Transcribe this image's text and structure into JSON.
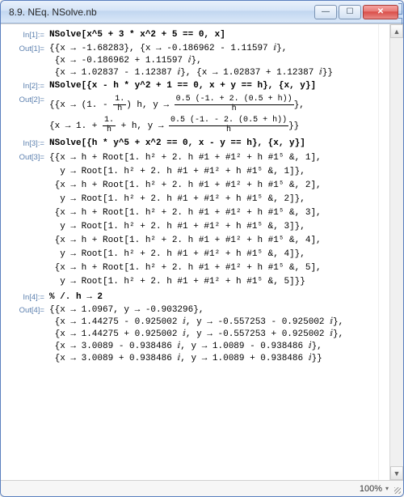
{
  "window": {
    "title": "8.9. NEq. NSolve.nb",
    "min_tooltip": "Minimize",
    "max_tooltip": "Maximize",
    "close_tooltip": "Close"
  },
  "status": {
    "zoom": "100%"
  },
  "cells": {
    "in1_label": "In[1]:=",
    "in1": "NSolve[x^5 + 3 * x^2 + 5 == 0, x]",
    "out1_label": "Out[1]=",
    "out1_l1": "{{x → -1.68283}, {x → -0.186962 - 1.11597 ⅈ},",
    "out1_l2": " {x → -0.186962 + 1.11597 ⅈ},",
    "out1_l3": " {x → 1.02837 - 1.12387 ⅈ}, {x → 1.02837 + 1.12387 ⅈ}}",
    "in2_label": "In[2]:=",
    "in2": "NSolve[{x - h * y^2 + 1 == 0, x + y == h}, {x, y}]",
    "out2_label": "Out[2]=",
    "out2_a_pre": "{{x → (1. - ",
    "out2_a_f1_num": "1.",
    "out2_a_f1_den": "h",
    "out2_a_mid": ") h, y → ",
    "out2_a_f2_num": "0.5 (-1. + 2. (0.5 + h))",
    "out2_a_f2_den": "h",
    "out2_a_post": "},",
    "out2_b_pre": " {x → 1. + ",
    "out2_b_f1_num": "1.",
    "out2_b_f1_den": "h",
    "out2_b_mid1": " + h, y → ",
    "out2_b_f2_num": "0.5 (-1. - 2. (0.5 + h))",
    "out2_b_f2_den": "h",
    "out2_b_post": "}}",
    "in3_label": "In[3]:=",
    "in3": "NSolve[{h * y^5 + x^2 == 0, x - y == h}, {x, y}]",
    "out3_label": "Out[3]=",
    "out3_l1": "{{x → h + Root[1. h² + 2. h #1 + #1² + h #1⁵ &, 1],",
    "out3_l2": "  y → Root[1. h² + 2. h #1 + #1² + h #1⁵ &, 1]},",
    "out3_l3": " {x → h + Root[1. h² + 2. h #1 + #1² + h #1⁵ &, 2],",
    "out3_l4": "  y → Root[1. h² + 2. h #1 + #1² + h #1⁵ &, 2]},",
    "out3_l5": " {x → h + Root[1. h² + 2. h #1 + #1² + h #1⁵ &, 3],",
    "out3_l6": "  y → Root[1. h² + 2. h #1 + #1² + h #1⁵ &, 3]},",
    "out3_l7": " {x → h + Root[1. h² + 2. h #1 + #1² + h #1⁵ &, 4],",
    "out3_l8": "  y → Root[1. h² + 2. h #1 + #1² + h #1⁵ &, 4]},",
    "out3_l9": " {x → h + Root[1. h² + 2. h #1 + #1² + h #1⁵ &, 5],",
    "out3_l10": "  y → Root[1. h² + 2. h #1 + #1² + h #1⁵ &, 5]}}",
    "in4_label": "In[4]:=",
    "in4": "% /. h → 2",
    "out4_label": "Out[4]=",
    "out4_l1": "{{x → 1.0967, y → -0.903296},",
    "out4_l2": " {x → 1.44275 - 0.925002 ⅈ, y → -0.557253 - 0.925002 ⅈ},",
    "out4_l3": " {x → 1.44275 + 0.925002 ⅈ, y → -0.557253 + 0.925002 ⅈ},",
    "out4_l4": " {x → 3.0089 - 0.938486 ⅈ, y → 1.0089 - 0.938486 ⅈ},",
    "out4_l5": " {x → 3.0089 + 0.938486 ⅈ, y → 1.0089 + 0.938486 ⅈ}}"
  }
}
